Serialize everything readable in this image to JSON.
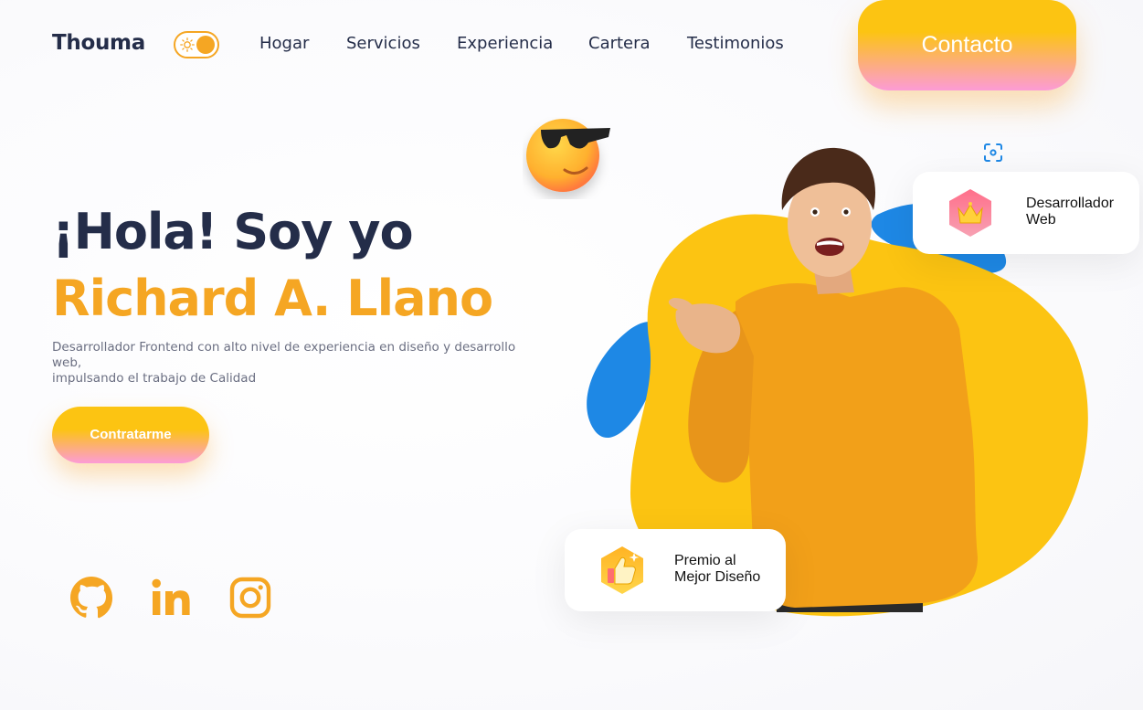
{
  "header": {
    "brand": "Thouma",
    "nav": [
      "Hogar",
      "Servicios",
      "Experiencia",
      "Cartera",
      "Testimonios"
    ],
    "contact_label": "Contacto",
    "theme_toggle": {
      "state": "light"
    }
  },
  "hero": {
    "greeting": "¡Hola! Soy yo",
    "name": "Richard A. Llano",
    "description_line1": "Desarrollador Frontend con alto nivel de experiencia en diseño y desarrollo web,",
    "description_line2": "impulsando el trabajo de Calidad",
    "cta_label": "Contratarme"
  },
  "social": [
    {
      "icon": "github-icon"
    },
    {
      "icon": "linkedin-icon"
    },
    {
      "icon": "instagram-icon"
    }
  ],
  "badges": {
    "web": {
      "line1": "Desarrollador",
      "line2": "Web",
      "icon": "crown-icon"
    },
    "award": {
      "line1": "Premio al",
      "line2": "Mejor Diseño",
      "icon": "thumbs-up-icon"
    }
  },
  "colors": {
    "accent": "#f5a623",
    "dark": "#242d49",
    "yellow_blob": "#fcc412",
    "blue_blob": "#1e88e5",
    "pink": "#fc9bd6"
  }
}
